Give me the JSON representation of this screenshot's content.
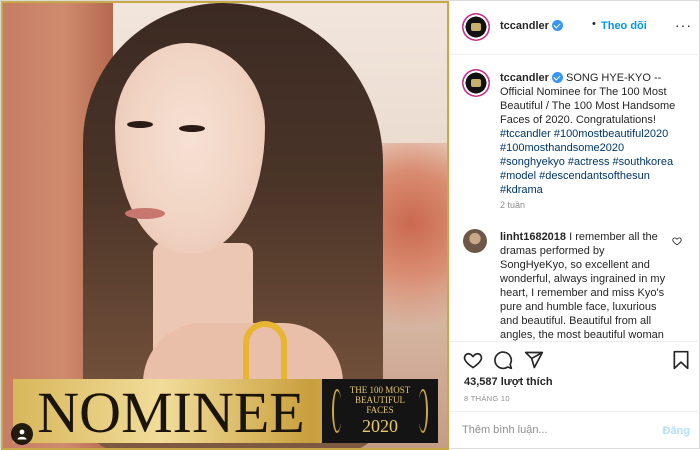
{
  "photo": {
    "banner_text": "NOMINEE",
    "seal_line1": "THE 100 MOST",
    "seal_line2": "BEAUTIFUL",
    "seal_line3": "FACES",
    "seal_year": "2020"
  },
  "header": {
    "username": "tccandler",
    "separator": "•",
    "follow_label": "Theo dõi",
    "more_label": "···"
  },
  "caption": {
    "username": "tccandler",
    "text": "SONG HYE-KYO -- Official Nominee for The 100 Most Beautiful / The 100 Most Handsome Faces of 2020. Congratulations!",
    "hashtags": [
      "#tccandler",
      "#100mostbeautiful2020",
      "#100mosthandsome2020",
      "#songhyekyo",
      "#actress",
      "#southkorea",
      "#model",
      "#descendantsofthesun",
      "#kdrama"
    ],
    "time": "2 tuần"
  },
  "comment": {
    "username": "linht1682018",
    "text": "I remember all the dramas performed by SongHyeKyo, so excellent and wonderful, always ingrained in my heart, I remember and miss Kyo's pure and humble face, luxurious and beautiful. Beautiful from all angles, the most beautiful woman"
  },
  "actions": {
    "likes": "43,587 lượt thích",
    "date": "8 THÁNG 10"
  },
  "comment_box": {
    "placeholder": "Thêm bình luận...",
    "post_label": "Đăng"
  },
  "colors": {
    "link": "#0095f6",
    "hashtag": "#00376b",
    "gold": "#d8b75b"
  }
}
